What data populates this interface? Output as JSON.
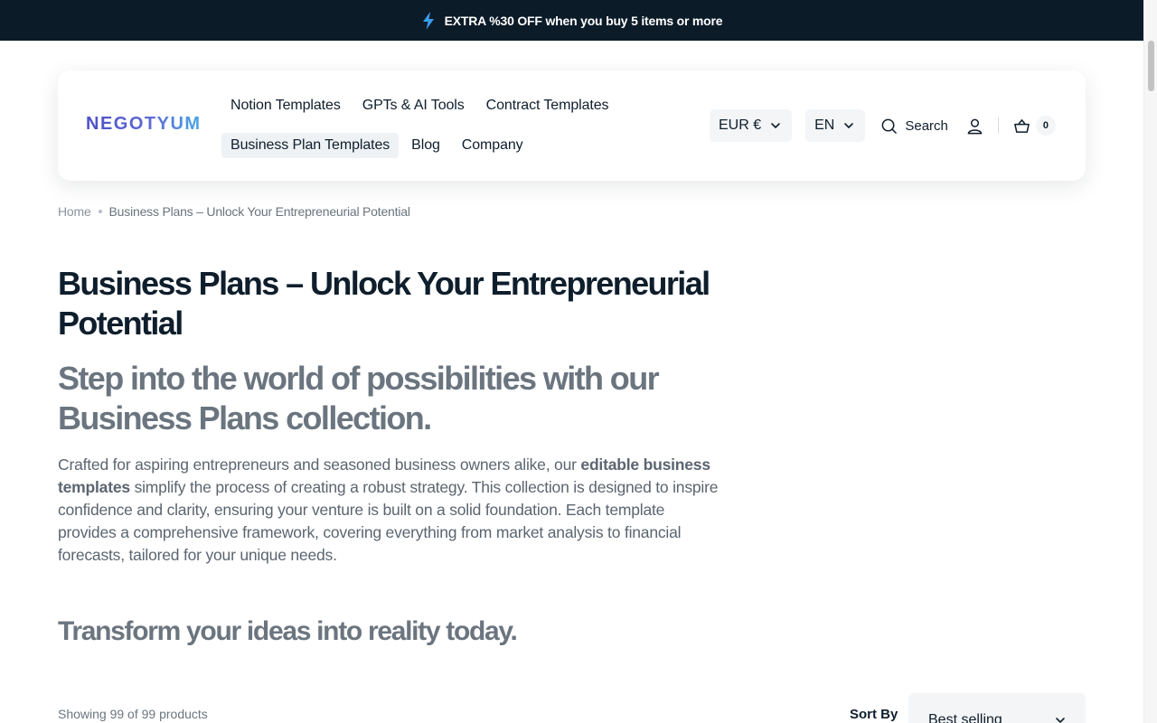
{
  "announcement": {
    "text": "EXTRA %30 OFF when you buy 5 items or more"
  },
  "header": {
    "logo": "NEGOTYUM",
    "nav_row1": [
      "Notion Templates",
      "GPTs & AI Tools",
      "Contract Templates"
    ],
    "nav_row2": [
      "Business Plan Templates",
      "Blog",
      "Company"
    ],
    "currency": "EUR €",
    "language": "EN",
    "search_label": "Search",
    "cart_count": "0"
  },
  "breadcrumb": {
    "home": "Home",
    "current": "Business Plans – Unlock Your Entrepreneurial Potential"
  },
  "page": {
    "title": "Business Plans – Unlock Your Entrepreneurial Potential",
    "subtitle": "Step into the world of possibilities with our Business Plans collection.",
    "desc_before": "Crafted for aspiring entrepreneurs and seasoned business owners alike, our ",
    "desc_bold": "editable business templates",
    "desc_after": " simplify the process of creating a robust strategy. This collection is designed to inspire confidence and clarity, ensuring your venture is built on a solid foundation. Each template provides a comprehensive framework, covering everything from market analysis to financial forecasts, tailored for your unique needs.",
    "tagline": "Transform your ideas into reality today."
  },
  "toolbar": {
    "count_text": "Showing 99 of 99 products",
    "sort_label": "Sort By",
    "sort_value": "Best selling"
  },
  "colors": {
    "announce_bg": "#0c1b28",
    "bolt": "#3b9cf0",
    "text_dark": "#0f1e2c",
    "text_muted": "#6b757f",
    "logo_gradient_start": "#4b4fc9",
    "logo_gradient_end": "#46a6e6"
  },
  "icons": {
    "announce": "lightning-bolt-icon",
    "dropdown": "chevron-down-icon",
    "search": "search-icon",
    "account": "user-icon",
    "cart": "basket-icon"
  }
}
